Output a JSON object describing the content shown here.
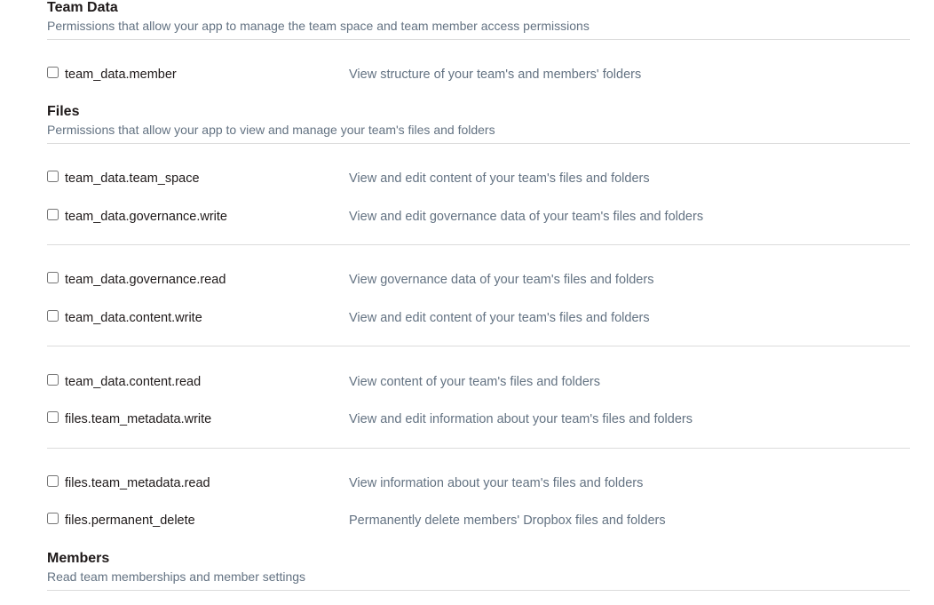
{
  "sections": {
    "team_data": {
      "title": "Team Data",
      "description": "Permissions that allow your app to manage the team space and team member access permissions",
      "permissions": [
        {
          "scope": "team_data.member",
          "description": "View structure of your team's and members' folders",
          "checked": false
        }
      ]
    },
    "files": {
      "title": "Files",
      "description": "Permissions that allow your app to view and manage your team's files and folders",
      "permissions": [
        {
          "scope": "team_data.team_space",
          "description": "View and edit content of your team's files and folders",
          "checked": false
        },
        {
          "scope": "team_data.governance.write",
          "description": "View and edit governance data of your team's files and folders",
          "checked": false
        },
        {
          "scope": "team_data.governance.read",
          "description": "View governance data of your team's files and folders",
          "checked": false
        },
        {
          "scope": "team_data.content.write",
          "description": "View and edit content of your team's files and folders",
          "checked": false
        },
        {
          "scope": "team_data.content.read",
          "description": "View content of your team's files and folders",
          "checked": false
        },
        {
          "scope": "files.team_metadata.write",
          "description": "View and edit information about your team's files and folders",
          "checked": false
        },
        {
          "scope": "files.team_metadata.read",
          "description": "View information about your team's files and folders",
          "checked": false
        },
        {
          "scope": "files.permanent_delete",
          "description": "Permanently delete members' Dropbox files and folders",
          "checked": false
        }
      ]
    },
    "members": {
      "title": "Members",
      "description": "Read team memberships and member settings"
    }
  }
}
